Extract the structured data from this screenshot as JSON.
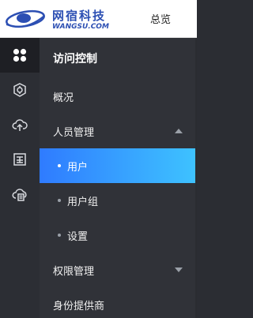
{
  "brand": {
    "name_cn": "网宿科技",
    "name_en": "WANGSU.COM",
    "logo_color": "#2c4fb3"
  },
  "topnav": {
    "overview": "总览"
  },
  "rail": {
    "items": [
      {
        "icon": "apps-grid-icon",
        "active": true
      },
      {
        "icon": "security-box-icon",
        "active": false
      },
      {
        "icon": "cloud-upload-icon",
        "active": false
      },
      {
        "icon": "certificate-icon",
        "active": false
      },
      {
        "icon": "cloud-storage-icon",
        "active": false
      }
    ]
  },
  "panel": {
    "title": "访问控制",
    "menu": [
      {
        "label": "概况"
      },
      {
        "label": "人员管理",
        "expanded": true
      },
      {
        "label": "用户",
        "active": true
      },
      {
        "label": "用户组"
      },
      {
        "label": "设置"
      },
      {
        "label": "权限管理",
        "expanded": false
      },
      {
        "label": "身份提供商"
      }
    ]
  },
  "colors": {
    "active_gradient_start": "#2f7bff",
    "active_gradient_end": "#3ec3ff",
    "panel_bg": "#303238",
    "rail_bg": "#2c2e34"
  }
}
